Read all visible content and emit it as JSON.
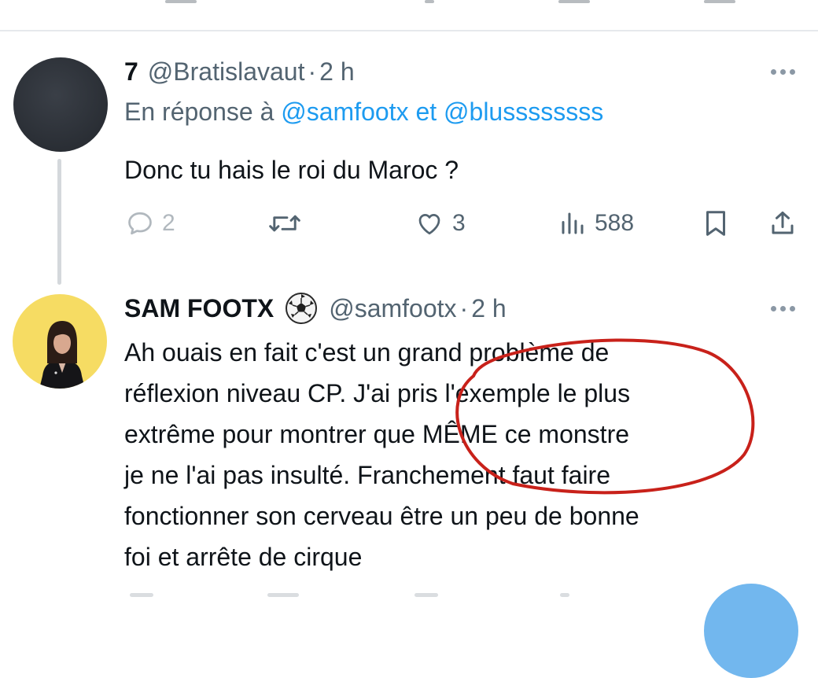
{
  "tweets": [
    {
      "display_name": "7",
      "handle": "@Bratislavaut",
      "separator": "·",
      "time": "2 h",
      "reply_prefix": "En réponse à",
      "reply_mention_1": "@samfootx",
      "reply_conjunction": "et",
      "reply_mention_2": "@blussssssss",
      "text": "Donc tu hais le roi du Maroc ?",
      "actions": {
        "replies": "2",
        "retweets": "",
        "likes": "3",
        "views": "588"
      }
    },
    {
      "display_name": "SAM FOOTX",
      "badge_icon": "soccer-ball-icon",
      "handle": "@samfootx",
      "separator": "·",
      "time": "2 h",
      "text_lines": [
        "Ah ouais en fait c'est un grand problème de",
        "réflexion niveau CP. J'ai pris l'exemple le plus",
        "extrême pour montrer que MÊME ce monstre",
        "je ne l'ai pas insulté. Franchement faut faire",
        "fonctionner son cerveau être un peu de bonne",
        "foi et arrête de cirque"
      ]
    }
  ],
  "colors": {
    "text": "#0f1419",
    "secondary": "#536471",
    "mention": "#1d9bf0",
    "annotation": "#c8211a",
    "avatar2_bg": "#f6dc63"
  }
}
